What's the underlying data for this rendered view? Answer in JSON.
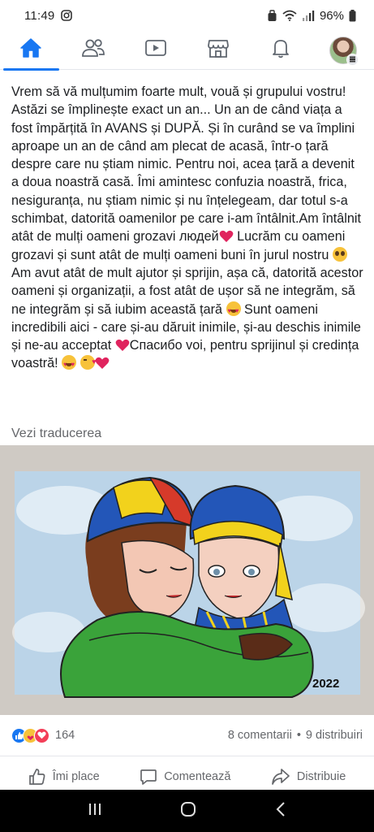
{
  "status_bar": {
    "time": "11:49",
    "battery": "96%"
  },
  "nav": {
    "tabs": [
      {
        "icon": "home-icon",
        "active": true
      },
      {
        "icon": "friends-icon",
        "active": false
      },
      {
        "icon": "video-icon",
        "active": false
      },
      {
        "icon": "marketplace-icon",
        "active": false
      },
      {
        "icon": "bell-icon",
        "active": false
      },
      {
        "icon": "profile-avatar",
        "active": false
      }
    ]
  },
  "post": {
    "text_segments": [
      "Vrem să vă mulțumim foarte mult, vouă și grupului vostru! Astăzi se împlinește exact un an... Un an de când viața a fost împărțită în AVANS și DUPĂ. Și în curând se va împlini aproape un an de când am plecat de acasă, într-o țară despre care nu știam nimic. Pentru noi, acea țară a devenit a doua noastră casă. Îmi amintesc confuzia noastră, frica, nesiguranța, nu știam nimic și nu înțelegeam, dar totul s-a schimbat, datorită oamenilor pe care i-am întâlnit.Am întâlnit atât de mulți oameni grozavi людей",
      " Lucrăm cu oameni grozavi și sunt atât de mulți oameni buni în jurul nostru ",
      " Am avut atât de mult ajutor și sprijin, așa că, datorită acestor oameni și organizații, a fost atât de ușor să ne integrăm, să ne integrăm și să iubim această țară ",
      " Sunt oameni incredibili aici - care și-au dăruit inimile, și-au deschis inimile și ne-au acceptat ",
      "Спасибо voi, pentru sprijinul și credința voastră! ",
      " "
    ],
    "see_translation": "Vezi traducerea",
    "image_caption_year": "2022"
  },
  "reactions": {
    "count": "164",
    "comments": "8 comentarii",
    "separator": "•",
    "shares": "9 distribuiri"
  },
  "actions": {
    "like": "Îmi place",
    "comment": "Comentează",
    "share": "Distribuie"
  },
  "colors": {
    "accent": "#1877f2",
    "secondary_text": "#65676b",
    "heart": "#e0245e"
  }
}
